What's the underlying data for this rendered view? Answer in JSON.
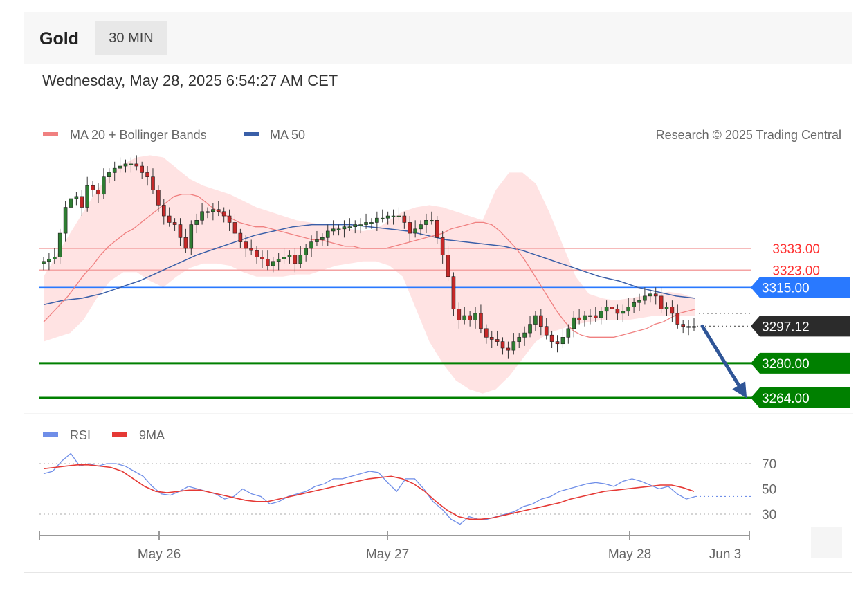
{
  "header": {
    "asset": "Gold",
    "timeframe": "30 MIN"
  },
  "datetime": "Wednesday, May 28, 2025 6:54:27 AM CET",
  "legend": {
    "ma20": "MA 20 + Bollinger Bands",
    "ma50": "MA 50"
  },
  "copyright": "Research © 2025 Trading Central",
  "rsi_legend": {
    "rsi": "RSI",
    "ma9": "9MA"
  },
  "colors": {
    "ma20": "#f08080",
    "band": "#ffe0e0",
    "ma50": "#3a5fa8",
    "resistance": "#ff6b6b",
    "pivot": "#2979ff",
    "support": "#008000",
    "last": "#2b2b2b",
    "up": "#2e7d32",
    "down": "#c62828",
    "arrow": "#2f5597",
    "rsi": "#6f8ee8",
    "rsi_ma": "#e53935"
  },
  "icons": {
    "arrow": "down-arrow-icon"
  },
  "chart_data": [
    {
      "type": "candlestick",
      "title": "Gold",
      "interval": "30 MIN",
      "x_ticks": [
        "May 26",
        "May 27",
        "May 28",
        "Jun 3"
      ],
      "ylim": [
        3255,
        3385
      ],
      "levels": [
        {
          "label": "3333.00",
          "value": 3333.0,
          "kind": "resistance"
        },
        {
          "label": "3323.00",
          "value": 3323.0,
          "kind": "resistance"
        },
        {
          "label": "3315.00",
          "value": 3315.0,
          "kind": "pivot"
        },
        {
          "label": "3297.12",
          "value": 3297.12,
          "kind": "last"
        },
        {
          "label": "3280.00",
          "value": 3280.0,
          "kind": "support"
        },
        {
          "label": "3264.00",
          "value": 3264.0,
          "kind": "support"
        }
      ],
      "close": [
        3327,
        3328,
        3329,
        3340,
        3352,
        3356,
        3357,
        3352,
        3362,
        3360,
        3358,
        3366,
        3368,
        3370,
        3371,
        3372,
        3372,
        3371,
        3368,
        3366,
        3360,
        3353,
        3348,
        3345,
        3344,
        3338,
        3333,
        3344,
        3346,
        3350,
        3350,
        3351,
        3350,
        3348,
        3345,
        3340,
        3336,
        3333,
        3332,
        3329,
        3328,
        3325,
        3327,
        3328,
        3329,
        3330,
        3326,
        3330,
        3333,
        3336,
        3337,
        3338,
        3341,
        3342,
        3342,
        3343,
        3343,
        3344,
        3344,
        3345,
        3345,
        3347,
        3347,
        3348,
        3348,
        3348,
        3345,
        3340,
        3342,
        3344,
        3346,
        3346,
        3338,
        3330,
        3320,
        3305,
        3300,
        3302,
        3300,
        3303,
        3296,
        3292,
        3291,
        3290,
        3287,
        3286,
        3290,
        3292,
        3294,
        3298,
        3302,
        3297,
        3293,
        3290,
        3289,
        3292,
        3296,
        3301,
        3300,
        3302,
        3302,
        3301,
        3304,
        3306,
        3305,
        3303,
        3304,
        3306,
        3308,
        3309,
        3311,
        3312,
        3311,
        3305,
        3306,
        3303,
        3298,
        3297,
        3297,
        3297
      ],
      "ma20": [
        3299,
        3303,
        3307,
        3311,
        3316,
        3321,
        3325,
        3330,
        3334,
        3337,
        3340,
        3342,
        3345,
        3348,
        3351,
        3354,
        3357,
        3358,
        3358,
        3357,
        3354,
        3351,
        3349,
        3347,
        3345,
        3344,
        3343,
        3343,
        3342,
        3341,
        3340,
        3339,
        3338,
        3337,
        3337,
        3336,
        3335,
        3334,
        3334,
        3333,
        3333,
        3333,
        3333,
        3334,
        3335,
        3336,
        3337,
        3338,
        3339,
        3340,
        3342,
        3343,
        3344,
        3345,
        3345,
        3344,
        3341,
        3337,
        3333,
        3328,
        3322,
        3316,
        3310,
        3304,
        3299,
        3295,
        3293,
        3292,
        3292,
        3292,
        3292,
        3293,
        3294,
        3295,
        3296,
        3298,
        3299,
        3301,
        3303,
        3304,
        3305
      ],
      "ma50": [
        3307,
        3309,
        3310,
        3312,
        3315,
        3318,
        3322,
        3326,
        3330,
        3333,
        3336,
        3339,
        3341,
        3343,
        3344,
        3344,
        3344,
        3343,
        3342,
        3341,
        3339,
        3337,
        3336,
        3335,
        3334,
        3332,
        3329,
        3326,
        3323,
        3320,
        3318,
        3315,
        3313,
        3311,
        3310
      ],
      "upper_band": [
        3320,
        3330,
        3340,
        3350,
        3360,
        3367,
        3372,
        3375,
        3376,
        3375,
        3370,
        3365,
        3362,
        3360,
        3358,
        3355,
        3352,
        3350,
        3348,
        3346,
        3345,
        3344,
        3343,
        3342,
        3341,
        3342,
        3346,
        3350,
        3352,
        3353,
        3352,
        3350,
        3348,
        3346,
        3360,
        3368,
        3368,
        3363,
        3350,
        3335,
        3320,
        3312,
        3310,
        3309,
        3310,
        3311,
        3312,
        3313,
        3312,
        3310
      ],
      "lower_band": [
        3290,
        3292,
        3294,
        3300,
        3310,
        3318,
        3322,
        3322,
        3318,
        3315,
        3320,
        3324,
        3326,
        3326,
        3325,
        3322,
        3320,
        3320,
        3320,
        3321,
        3321,
        3323,
        3325,
        3326,
        3327,
        3327,
        3325,
        3320,
        3305,
        3290,
        3280,
        3272,
        3268,
        3266,
        3268,
        3274,
        3282,
        3290,
        3294,
        3296,
        3298,
        3299,
        3300,
        3300,
        3300,
        3301,
        3302,
        3302,
        3302,
        3302
      ]
    },
    {
      "type": "line",
      "title": "RSI",
      "yticks": [
        70,
        50,
        30
      ],
      "ylim": [
        14,
        80
      ],
      "series": [
        {
          "name": "RSI",
          "values": [
            62,
            64,
            72,
            78,
            68,
            70,
            68,
            70,
            70,
            68,
            64,
            60,
            52,
            46,
            45,
            48,
            52,
            50,
            48,
            46,
            42,
            44,
            50,
            46,
            44,
            38,
            40,
            44,
            46,
            48,
            52,
            54,
            58,
            58,
            60,
            62,
            64,
            63,
            55,
            48,
            58,
            58,
            50,
            40,
            34,
            26,
            22,
            28,
            26,
            26,
            28,
            30,
            32,
            36,
            38,
            42,
            44,
            48,
            50,
            52,
            54,
            55,
            54,
            52,
            56,
            58,
            56,
            53,
            50,
            52,
            46,
            42,
            44
          ]
        },
        {
          "name": "9MA",
          "values": [
            66,
            67,
            68,
            69,
            69,
            68,
            67,
            64,
            58,
            52,
            48,
            47,
            48,
            49,
            49,
            47,
            45,
            43,
            41,
            40,
            40,
            42,
            44,
            46,
            48,
            50,
            52,
            54,
            56,
            58,
            59,
            60,
            58,
            54,
            48,
            40,
            33,
            28,
            26,
            26,
            27,
            29,
            31,
            33,
            35,
            37,
            39,
            42,
            44,
            46,
            48,
            49,
            50,
            51,
            52,
            53,
            53,
            51,
            48
          ]
        }
      ]
    }
  ]
}
